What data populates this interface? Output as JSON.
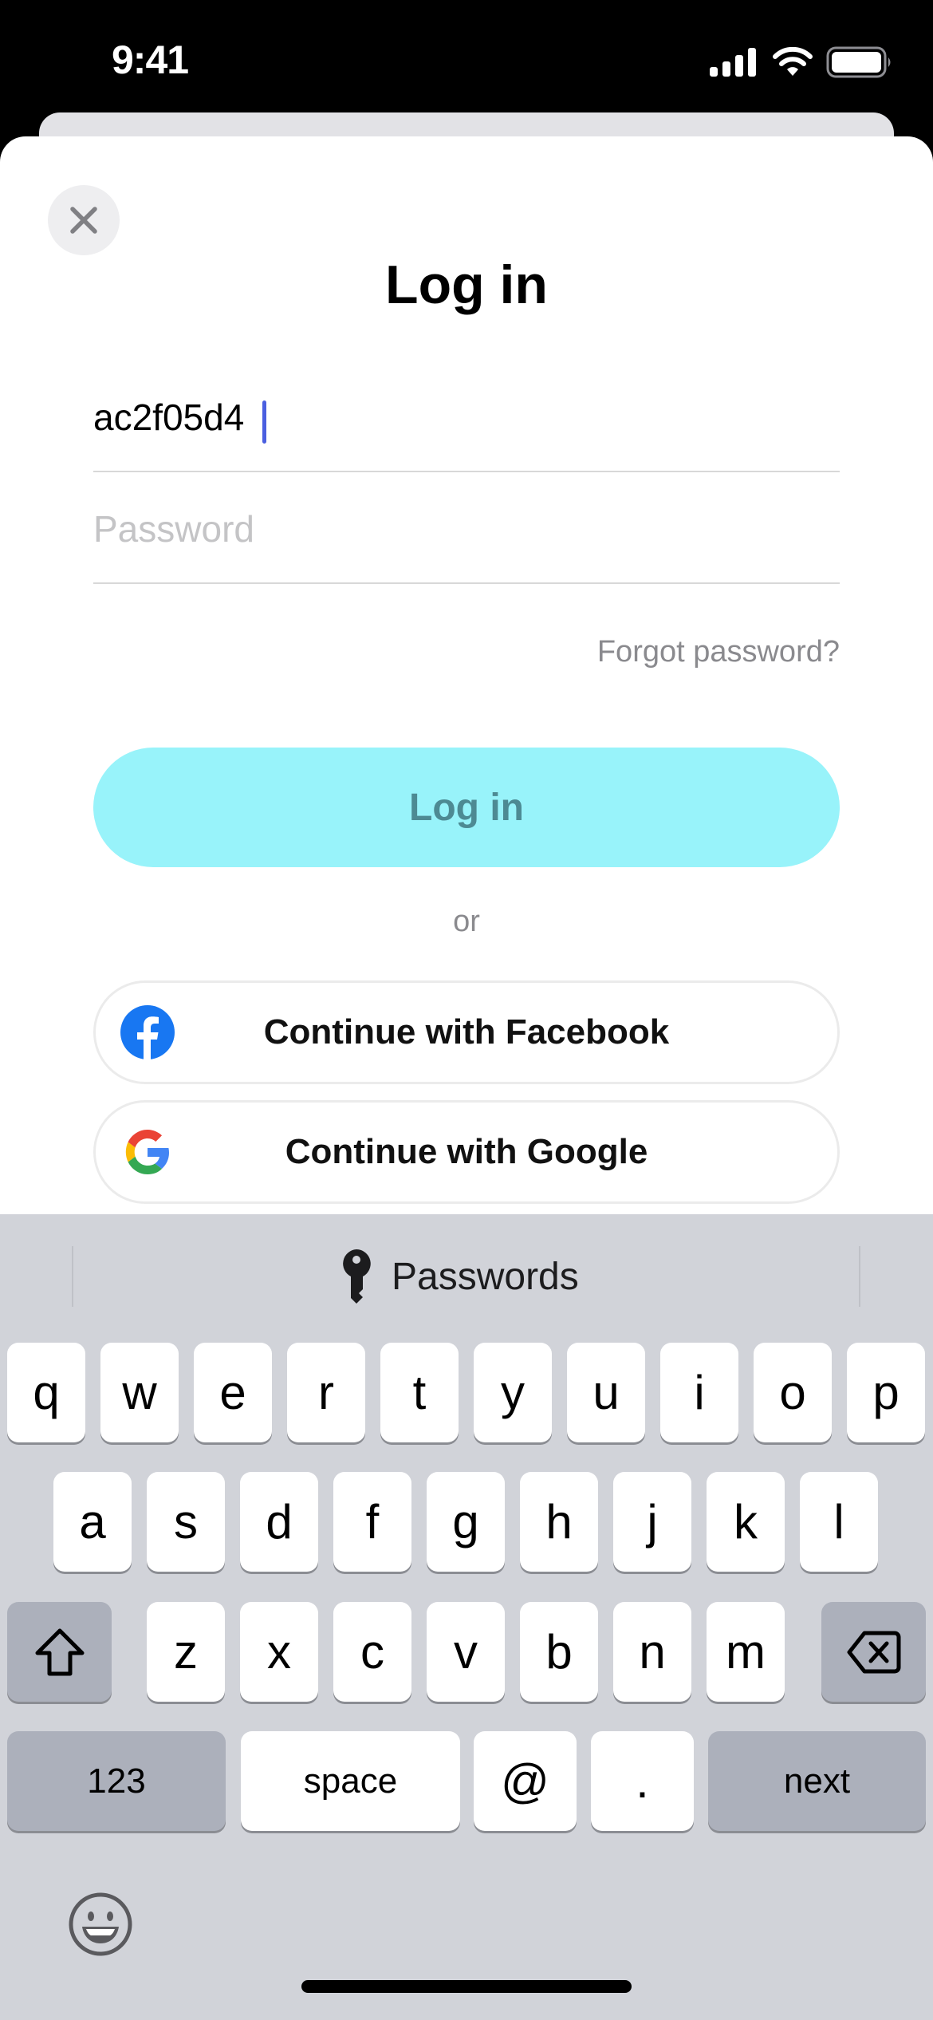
{
  "status_bar": {
    "time": "9:41",
    "icons": [
      "cellular-signal-icon",
      "wifi-icon",
      "battery-icon"
    ]
  },
  "sheet": {
    "close_icon": "close-icon",
    "title": "Log in",
    "username": {
      "value": "ac2f05d4",
      "placeholder": ""
    },
    "password": {
      "value": "",
      "placeholder": "Password"
    },
    "forgot_password": "Forgot password?",
    "login_button": "Log in",
    "divider_text": "or",
    "social": [
      {
        "label": "Continue with Facebook",
        "icon": "facebook-icon"
      },
      {
        "label": "Continue with Google",
        "icon": "google-icon"
      }
    ],
    "colors": {
      "login_button_bg": "#98F3FA",
      "login_button_text": "#4D8A93",
      "caret": "#4A5FE0",
      "facebook_blue": "#1877F2"
    }
  },
  "keyboard": {
    "suggestion": {
      "icon": "key-icon",
      "label": "Passwords"
    },
    "rows": [
      [
        "q",
        "w",
        "e",
        "r",
        "t",
        "y",
        "u",
        "i",
        "o",
        "p"
      ],
      [
        "a",
        "s",
        "d",
        "f",
        "g",
        "h",
        "j",
        "k",
        "l"
      ],
      [
        "shift",
        "z",
        "x",
        "c",
        "v",
        "b",
        "n",
        "m",
        "delete"
      ],
      [
        "123",
        "space",
        "@",
        ".",
        "next"
      ]
    ],
    "row1": [
      "q",
      "w",
      "e",
      "r",
      "t",
      "y",
      "u",
      "i",
      "o",
      "p"
    ],
    "row2": [
      "a",
      "s",
      "d",
      "f",
      "g",
      "h",
      "j",
      "k",
      "l"
    ],
    "row3": [
      "z",
      "x",
      "c",
      "v",
      "b",
      "n",
      "m"
    ],
    "numbers_label": "123",
    "space_label": "space",
    "at_label": "@",
    "period_label": ".",
    "return_label": "next",
    "emoji_icon": "emoji-icon"
  }
}
